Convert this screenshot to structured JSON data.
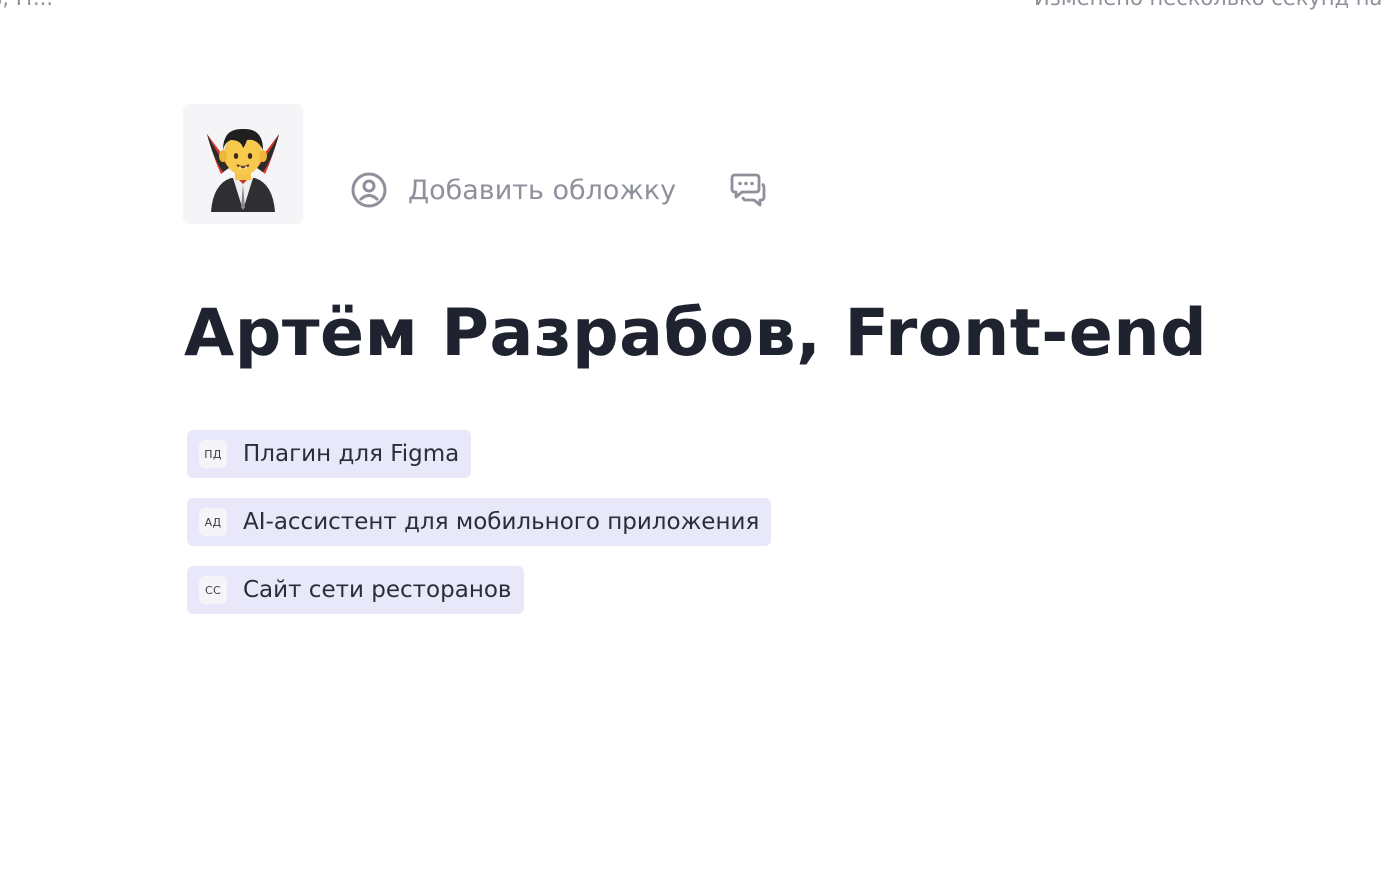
{
  "topbar": {
    "breadcrumb_fragment": "в, Fr...",
    "status": "Изменено несколько секунд назад"
  },
  "page": {
    "icon_name": "vampire-emoji-icon",
    "add_cover_label": "Добавить обложку",
    "title": "Артём Разрабов, Front-end"
  },
  "links": [
    {
      "badge": "ПД",
      "label": "Плагин для Figma"
    },
    {
      "badge": "АД",
      "label": "AI-ассистент для мобильного приложения"
    },
    {
      "badge": "СС",
      "label": "Сайт сети ресторанов"
    }
  ],
  "colors": {
    "chip_background": "#e9e8fb",
    "muted_text": "#8e919b",
    "title_text": "#1f2330"
  }
}
